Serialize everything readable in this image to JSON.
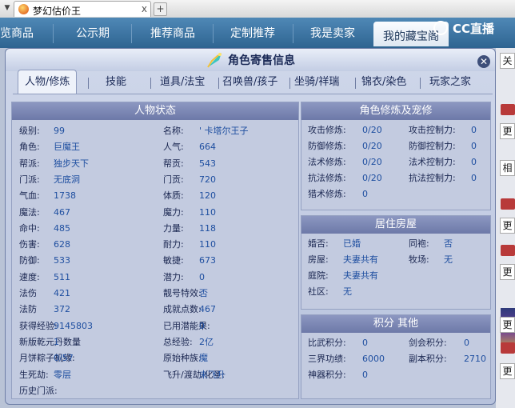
{
  "browser": {
    "tab_title": "梦幻估价王",
    "tab_close": "x",
    "new_tab": "+"
  },
  "site_nav": {
    "items": [
      "览商品",
      "公示期",
      "推荐商品",
      "定制推荐",
      "我是卖家",
      "我的藏宝阁"
    ],
    "active_index": 5
  },
  "overlay_logo": "CC直播",
  "right_strip": {
    "items": [
      "关",
      "更",
      "相",
      "更",
      "更",
      "更",
      "更"
    ]
  },
  "dialog": {
    "title": "角色寄售信息",
    "close": "✕",
    "tabs": [
      "人物/修炼",
      "技能",
      "道具/法宝",
      "召唤兽/孩子",
      "坐骑/祥瑞",
      "锦衣/染色",
      "玩家之家"
    ],
    "active_tab": 0
  },
  "char_status": {
    "title": "人物状态",
    "rows": [
      {
        "l1": "级别:",
        "v1": "99",
        "l2": "名称:",
        "v2": "' 卡塔尔王子"
      },
      {
        "l1": "角色:",
        "v1": "巨魔王",
        "l2": "人气:",
        "v2": "664"
      },
      {
        "l1": "帮派:",
        "v1": "独步天下",
        "l2": "帮贡:",
        "v2": "543"
      },
      {
        "l1": "门派:",
        "v1": "无底洞",
        "l2": "门贡:",
        "v2": "720"
      },
      {
        "l1": "气血:",
        "v1": "1738",
        "l2": "体质:",
        "v2": "120"
      },
      {
        "l1": "魔法:",
        "v1": "467",
        "l2": "魔力:",
        "v2": "110"
      },
      {
        "l1": "命中:",
        "v1": "485",
        "l2": "力量:",
        "v2": "118"
      },
      {
        "l1": "伤害:",
        "v1": "628",
        "l2": "耐力:",
        "v2": "110"
      },
      {
        "l1": "防御:",
        "v1": "533",
        "l2": "敏捷:",
        "v2": "673"
      },
      {
        "l1": "速度:",
        "v1": "511",
        "l2": "潜力:",
        "v2": "0"
      },
      {
        "l1": "法伤",
        "v1": "421",
        "l2": "靓号特效:",
        "v2": "否"
      },
      {
        "l1": "法防",
        "v1": "372",
        "l2": "成就点数:",
        "v2": "467"
      },
      {
        "l1": "获得经验:",
        "v1": "9145803",
        "l2": "已用潜能果:",
        "v2": "0"
      },
      {
        "l1": "新版乾元丹数量",
        "v1": "1",
        "l2": "总经验:",
        "v2": "2亿"
      },
      {
        "l1": "月饼粽子机缘:",
        "v1": "0/57",
        "l2": "原始种族:",
        "v2": "魔"
      },
      {
        "l1": "生死劫:",
        "v1": "零层",
        "l2": "飞升/渡劫/化圣:",
        "v2": "未飞升"
      },
      {
        "l1": "历史门派:",
        "v1": "",
        "l2": "",
        "v2": ""
      }
    ]
  },
  "cultivation": {
    "title": "角色修炼及宠修",
    "rows": [
      {
        "l1": "攻击修炼:",
        "v1": "0/20",
        "l2": "攻击控制力:",
        "v2": "0"
      },
      {
        "l1": "防御修炼:",
        "v1": "0/20",
        "l2": "防御控制力:",
        "v2": "0"
      },
      {
        "l1": "法术修炼:",
        "v1": "0/20",
        "l2": "法术控制力:",
        "v2": "0"
      },
      {
        "l1": "抗法修炼:",
        "v1": "0/20",
        "l2": "抗法控制力:",
        "v2": "0"
      },
      {
        "l1": "猎术修炼:",
        "v1": "0",
        "l2": "",
        "v2": ""
      }
    ]
  },
  "housing": {
    "title": "居住房屋",
    "rows": [
      {
        "l1": "婚否:",
        "v1": "已婚",
        "l2": "同袍:",
        "v2": "否"
      },
      {
        "l1": "房屋:",
        "v1": "夫妻共有",
        "l2": "牧场:",
        "v2": "无"
      },
      {
        "l1": "庭院:",
        "v1": "夫妻共有",
        "l2": "",
        "v2": ""
      },
      {
        "l1": "社区:",
        "v1": "无",
        "l2": "",
        "v2": ""
      }
    ]
  },
  "points": {
    "title": "积分 其他",
    "rows": [
      {
        "l1": "比武积分:",
        "v1": "0",
        "l2": "剑会积分:",
        "v2": "0"
      },
      {
        "l1": "三界功绩:",
        "v1": "6000",
        "l2": "副本积分:",
        "v2": "2710"
      },
      {
        "l1": "神器积分:",
        "v1": "0",
        "l2": "",
        "v2": ""
      }
    ]
  },
  "colors": {
    "header_bar": "#6d79a8",
    "value_blue": "#1f4fa0",
    "nav_blue": "#2e6491"
  }
}
